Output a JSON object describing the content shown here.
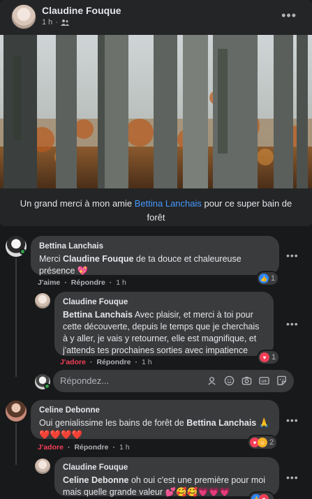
{
  "post": {
    "author": "Claudine Fouque",
    "time": "1 h",
    "caption_prefix": "Un grand merci à mon amie ",
    "caption_link": "Bettina Lanchais",
    "caption_suffix": " pour ce super bain de forêt"
  },
  "comments": [
    {
      "name": "Bettina Lanchais",
      "text_1": "Merci ",
      "mention": "Claudine Fouque",
      "text_2": " de ta douce et chaleureuse présence 💖",
      "reaction_label": "J'aime",
      "reply_label": "Répondre",
      "time": "1 h",
      "reaction_count": "1"
    },
    {
      "name": "Claudine Fouque",
      "mention": "Bettina Lanchais",
      "text": " Avec plaisir, et merci à toi pour cette découverte, depuis le temps que je cherchais à y aller, je vais y retourner, elle est magnifique, et j'attends tes prochaines sorties avec impatience",
      "reaction_label": "J'adore",
      "reply_label": "Répondre",
      "time": "1 h",
      "reaction_count": "1"
    },
    {
      "name": "Celine Debonne",
      "text_1": "Oui genialissime les bains de forêt de ",
      "mention": "Bettina Lanchais",
      "text_2": " 🙏❤️❤️❤️❤️",
      "reaction_label": "J'adore",
      "reply_label": "Répondre",
      "time": "1 h",
      "reaction_count": "2"
    },
    {
      "name": "Claudine Fouque",
      "mention": "Celine Debonne",
      "text": " oh oui c'est une première pour moi mais quelle grande valeur 💕🥰🥰💗💗💗"
    }
  ],
  "reply": {
    "placeholder": "Répondez..."
  },
  "icons": {
    "post_menu": "more-horizontal-icon",
    "audience": "friends-icon",
    "reactions": [
      "like-icon",
      "love-icon",
      "care-icon"
    ],
    "reply_tools": [
      "avatar-sticker-icon",
      "emoji-icon",
      "camera-icon",
      "gif-icon",
      "sticker-icon"
    ]
  }
}
